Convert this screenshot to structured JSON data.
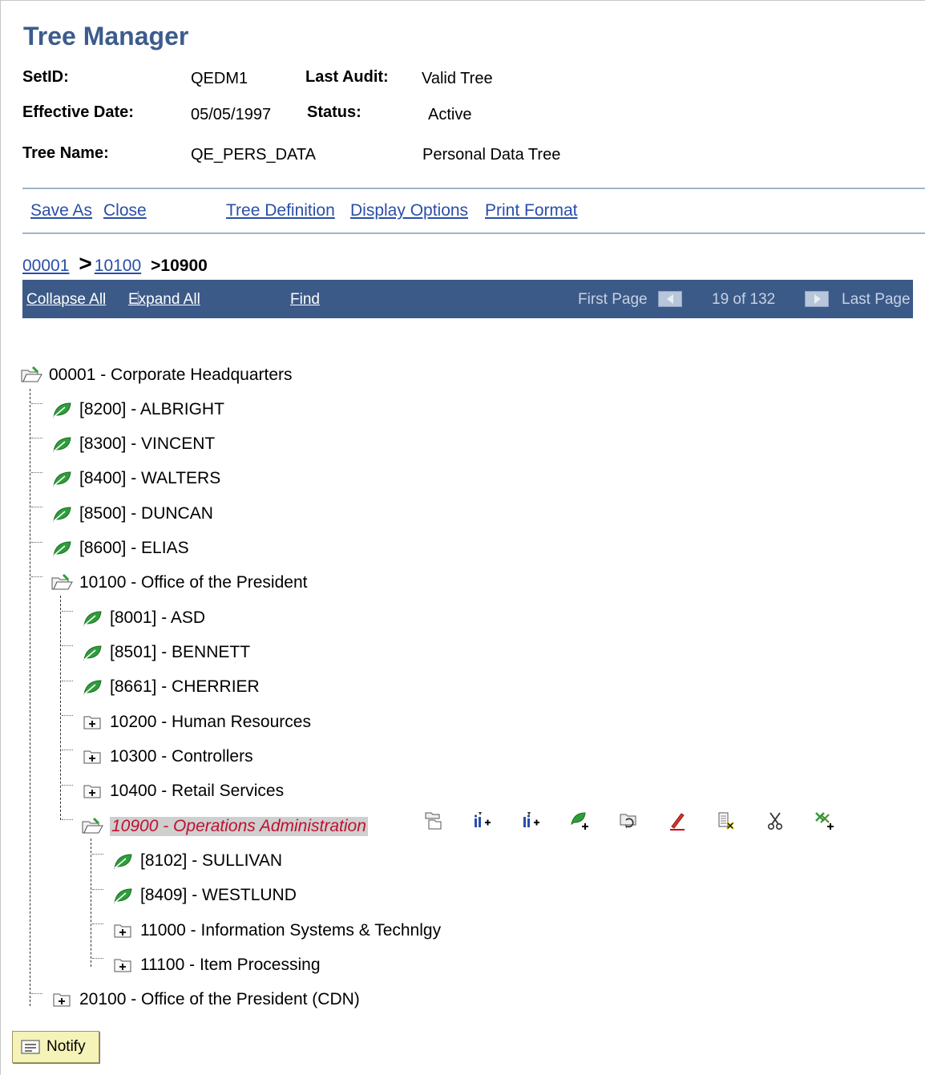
{
  "header": {
    "title": "Tree Manager",
    "setid_label": "SetID:",
    "setid_value": "QEDM1",
    "last_audit_label": "Last Audit:",
    "last_audit_value": "Valid Tree",
    "eff_date_label": "Effective Date:",
    "eff_date_value": "05/05/1997",
    "status_label": "Status:",
    "status_value": "Active",
    "tree_name_label": "Tree Name:",
    "tree_name_value": "QE_PERS_DATA",
    "tree_desc": "Personal Data Tree"
  },
  "actions": {
    "save_as": "Save As",
    "close": "Close",
    "tree_definition": "Tree Definition",
    "display_options": "Display Options",
    "print_format": "Print Format"
  },
  "breadcrumb": {
    "level1": "00001",
    "level2": "10100",
    "current": ">10900",
    "separator": ">"
  },
  "navbar": {
    "collapse_all": "Collapse All",
    "separator": "|",
    "expand_all": "Expand All",
    "find": "Find",
    "first_page": "First Page",
    "page_info": "19 of 132",
    "last_page": "Last Page"
  },
  "tree": {
    "root": "00001 - Corporate Headquarters",
    "n_8200": "[8200] - ALBRIGHT",
    "n_8300": "[8300] - VINCENT",
    "n_8400": "[8400] - WALTERS",
    "n_8500": "[8500] - DUNCAN",
    "n_8600": "[8600] - ELIAS",
    "n_10100": "10100 - Office of the President",
    "n_8001": "[8001] - ASD",
    "n_8501": "[8501] - BENNETT",
    "n_8661": "[8661] - CHERRIER",
    "n_10200": "10200 - Human Resources",
    "n_10300": "10300 - Controllers",
    "n_10400": "10400 - Retail Services",
    "n_10900": "10900 - Operations Administration",
    "n_8102": "[8102] - SULLIVAN",
    "n_8409": "[8409] - WESTLUND",
    "n_11000": "11000 - Information Systems & Technlgy",
    "n_11100": "11100 - Item Processing",
    "n_20100": "20100 - Office of the President (CDN)"
  },
  "notify_label": "Notify",
  "colors": {
    "title": "#3c5c8c",
    "link": "#2a4ea8",
    "navbar_bg": "#3c5a88",
    "leaf_green": "#2e9e3a",
    "selected_text": "#c01030"
  }
}
